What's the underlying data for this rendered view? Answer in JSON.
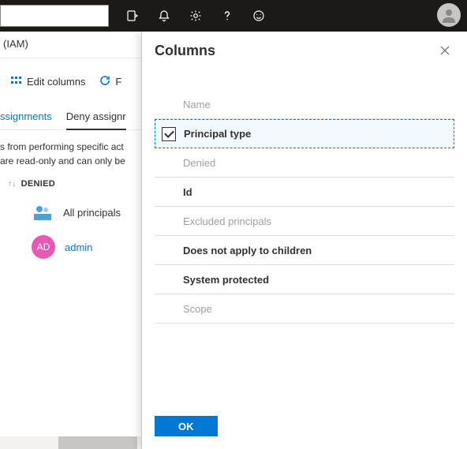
{
  "breadcrumb": "(IAM)",
  "toolbar": {
    "edit_columns": "Edit columns",
    "refresh_partial": "F"
  },
  "tabs": {
    "assignments": "ssignments",
    "deny": "Deny assignr"
  },
  "description": {
    "line1": "s from performing specific act",
    "line2": "are read-only and can only be"
  },
  "table": {
    "header_denied": "DENIED",
    "rows": [
      {
        "type": "principals",
        "label": "All principals"
      },
      {
        "type": "user",
        "badge": "AD",
        "label": "admin"
      }
    ]
  },
  "panel": {
    "title": "Columns",
    "ok": "OK",
    "columns": [
      {
        "label": "Name",
        "enabled": false,
        "checked": false,
        "highlight": false
      },
      {
        "label": "Principal type",
        "enabled": true,
        "checked": true,
        "highlight": true
      },
      {
        "label": "Denied",
        "enabled": false,
        "checked": false,
        "highlight": false
      },
      {
        "label": "Id",
        "enabled": true,
        "checked": false,
        "highlight": false
      },
      {
        "label": "Excluded principals",
        "enabled": false,
        "checked": false,
        "highlight": false
      },
      {
        "label": "Does not apply to children",
        "enabled": true,
        "checked": false,
        "highlight": false
      },
      {
        "label": "System protected",
        "enabled": true,
        "checked": false,
        "highlight": false
      },
      {
        "label": "Scope",
        "enabled": false,
        "checked": false,
        "highlight": false
      }
    ]
  }
}
